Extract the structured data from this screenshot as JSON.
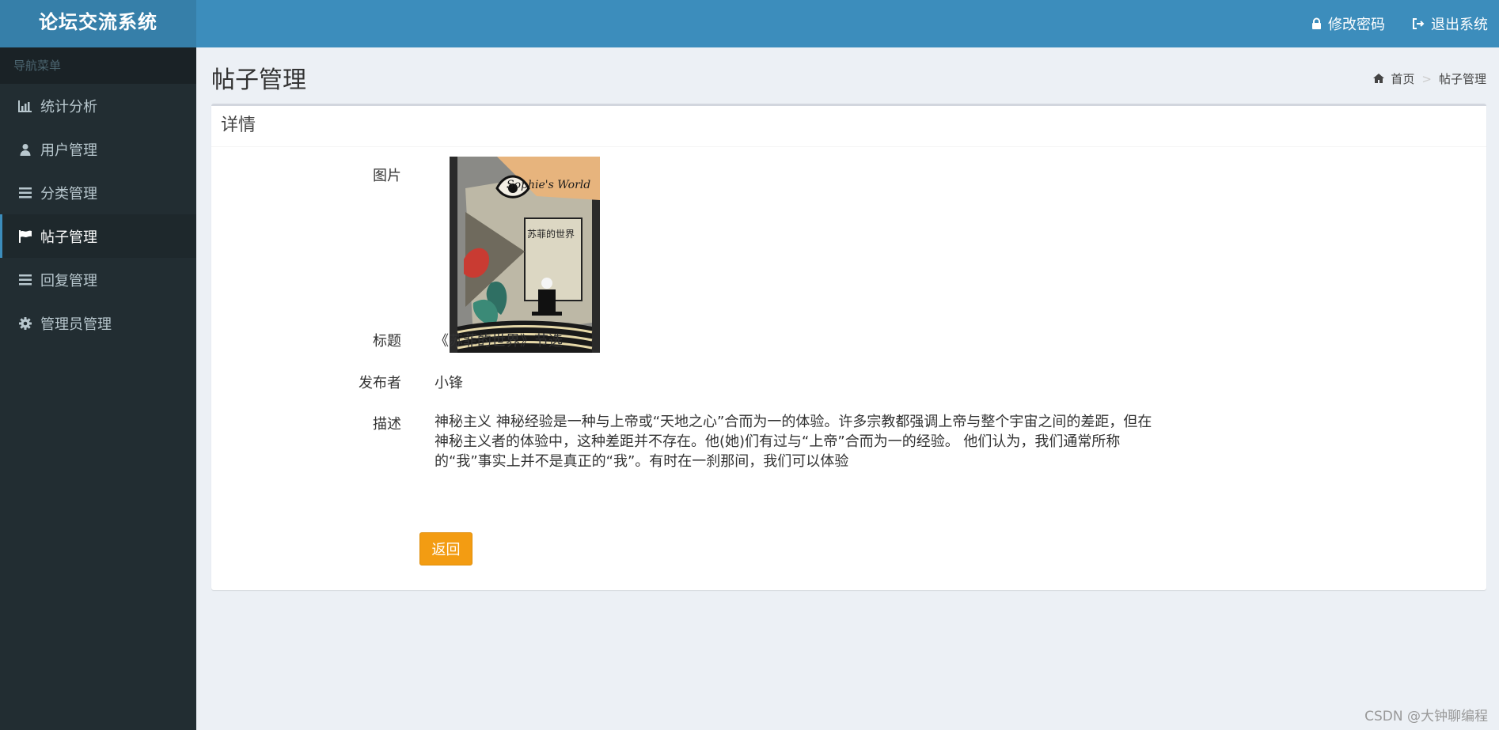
{
  "app": {
    "title": "论坛交流系统"
  },
  "header": {
    "change_password": "修改密码",
    "logout": "退出系统",
    "colors": {
      "bar": "#3c8dbc",
      "logo_bg": "#367fa9"
    }
  },
  "sidebar": {
    "heading": "导航菜单",
    "items": [
      {
        "label": "统计分析",
        "icon": "bar-chart-icon",
        "active": false
      },
      {
        "label": "用户管理",
        "icon": "user-icon",
        "active": false
      },
      {
        "label": "分类管理",
        "icon": "list-icon",
        "active": false
      },
      {
        "label": "帖子管理",
        "icon": "flag-icon",
        "active": true
      },
      {
        "label": "回复管理",
        "icon": "list-icon",
        "active": false
      },
      {
        "label": "管理员管理",
        "icon": "gear-icon",
        "active": false
      }
    ]
  },
  "content": {
    "page_title": "帖子管理",
    "breadcrumb": {
      "home": "首页",
      "current": "帖子管理"
    },
    "box_title": "详情",
    "fields": {
      "image_label": "图片",
      "title_label": "标题",
      "title_value": "《苏菲的世界》节选",
      "author_label": "发布者",
      "author_value": "小锋",
      "desc_label": "描述",
      "desc_value": "神秘主义 神秘经验是一种与上帝或“天地之心”合而为一的体验。许多宗教都强调上帝与整个宇宙之间的差距，但在神秘主义者的体验中，这种差距并不存在。他(她)们有过与“上帝”合而为一的经验。 他们认为，我们通常所称的“我”事实上并不是真正的“我”。有时在一刹那间，我们可以体验"
    },
    "book_cover": {
      "title_en": "Sophie's World",
      "title_cn": "苏菲的世界"
    },
    "back_button": "返回",
    "colors": {
      "back_button": "#f39c12"
    }
  },
  "watermark": "CSDN @大钟聊编程"
}
